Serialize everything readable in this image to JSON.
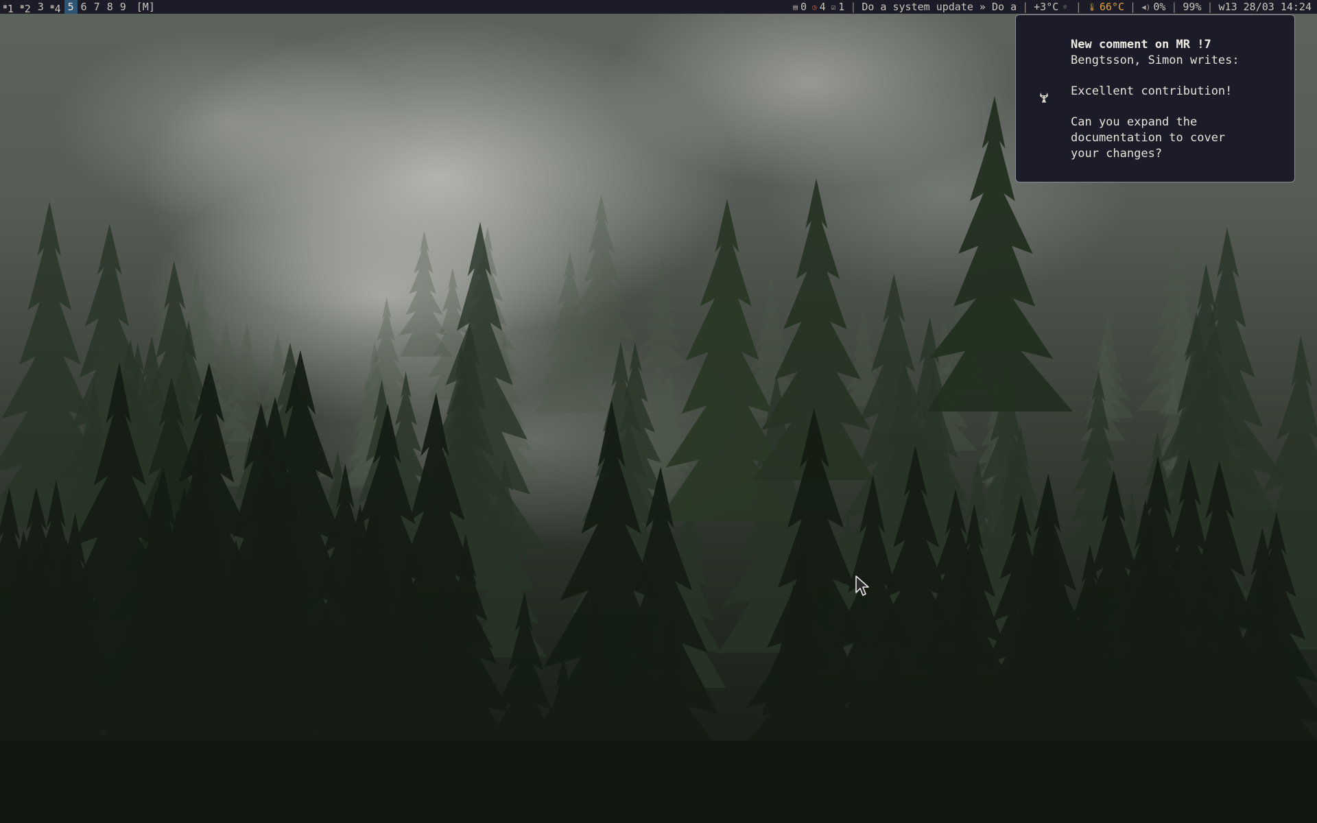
{
  "topbar": {
    "workspaces": [
      {
        "label": "1",
        "has_windows": true,
        "active": false
      },
      {
        "label": "2",
        "has_windows": true,
        "active": false
      },
      {
        "label": "3",
        "has_windows": false,
        "active": false
      },
      {
        "label": "4",
        "has_windows": true,
        "active": false
      },
      {
        "label": "5",
        "has_windows": false,
        "active": true
      },
      {
        "label": "6",
        "has_windows": false,
        "active": false
      },
      {
        "label": "7",
        "has_windows": false,
        "active": false
      },
      {
        "label": "8",
        "has_windows": false,
        "active": false
      },
      {
        "label": "9",
        "has_windows": false,
        "active": false
      }
    ],
    "layout_indicator": "[M]",
    "status": {
      "documents_count": "0",
      "alarms_count": "4",
      "tasks_done_count": "1",
      "todo_text": "Do a system update » Do a",
      "weather": "+3°C",
      "cpu_temp": "66°C",
      "volume": "0%",
      "battery": "99%",
      "datetime": "w13 28/03 14:24"
    },
    "icons": {
      "documents": "document-icon",
      "alarms": "clock-icon",
      "tasks": "checkbox-icon",
      "weather": "sun-icon",
      "cpu_temp": "thermometer-icon",
      "volume": "speaker-icon"
    },
    "colors": {
      "bar_background": "#1c1c28",
      "active_workspace": "#2e5673",
      "alarm_accent": "#c8583d",
      "temp_accent": "#e2a23a"
    }
  },
  "notification": {
    "icon": "gitlab-fox-icon",
    "title": "New comment on MR !7",
    "author_line": "Bengtsson, Simon writes:",
    "body_line_1": "Excellent contribution!",
    "body_line_2": "Can you expand the",
    "body_line_3": "documentation to cover",
    "body_line_4": "your changes?"
  }
}
